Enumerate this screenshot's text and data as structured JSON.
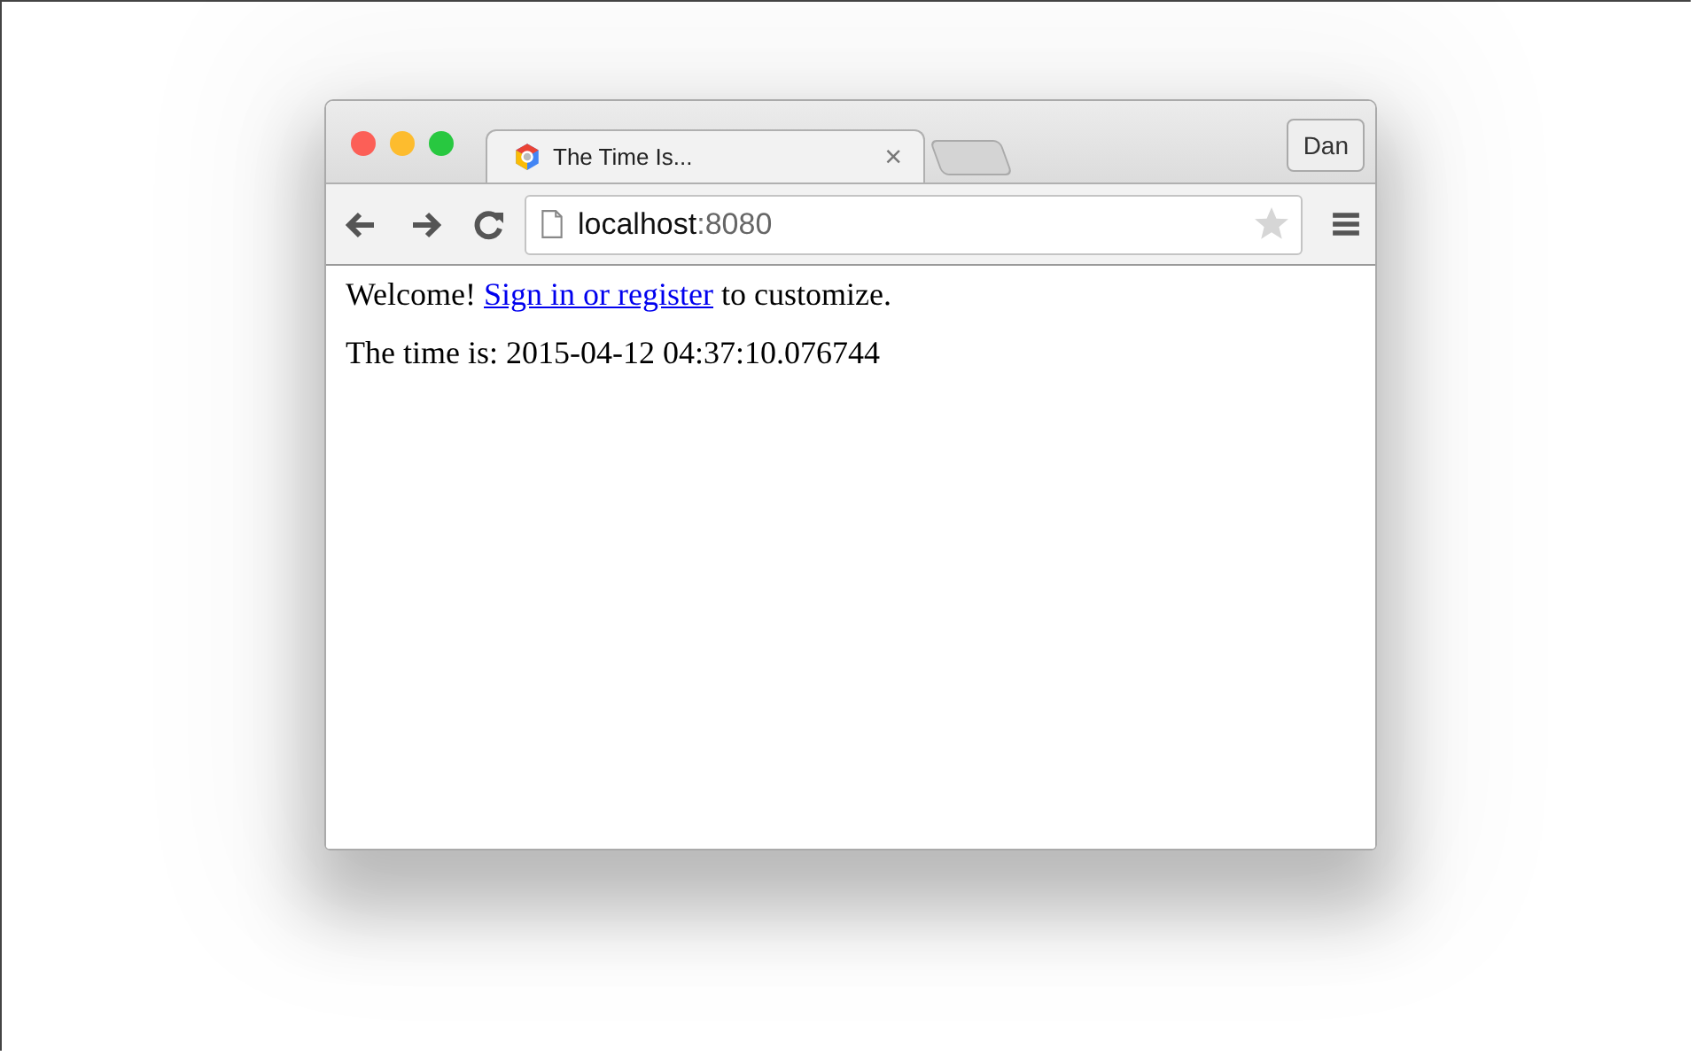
{
  "window": {
    "tabs": [
      {
        "title": "The Time Is...",
        "close": "×",
        "selected": true
      }
    ],
    "profile": "Dan"
  },
  "address_bar": {
    "host": "localhost",
    "port": ":8080",
    "bookmarked": false
  },
  "page": {
    "welcome": {
      "before": "Welcome! ",
      "link": "Sign in or register",
      "after": " to customize."
    },
    "time_text": "The time is: 2015-04-12 04:37:10.076744"
  }
}
